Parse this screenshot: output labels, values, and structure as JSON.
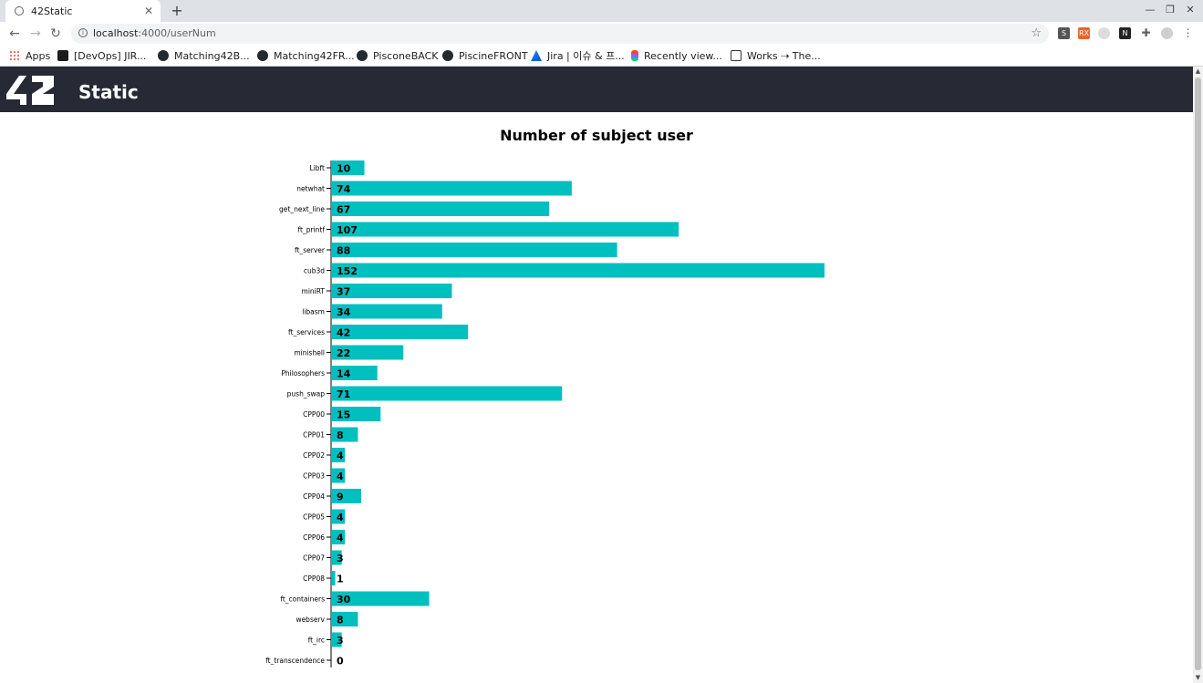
{
  "browser": {
    "tab_title": "42Static",
    "url_host": "localhost",
    "url_path": ":4000/userNum",
    "bookmarks": [
      "Apps",
      "[DevOps] JIR...",
      "Matching42B...",
      "Matching42FR...",
      "PisconeBACK",
      "PiscineFRONT",
      "Jira | 이슈 & 프...",
      "Recently view...",
      "Works ⇢ The..."
    ]
  },
  "page": {
    "brand": "Static",
    "logo_text": "42",
    "header_color": "#272a35"
  },
  "chart_data": {
    "type": "bar",
    "orientation": "horizontal",
    "title": "Number of subject user",
    "categories": [
      "Libft",
      "netwhat",
      "get_next_line",
      "ft_printf",
      "ft_server",
      "cub3d",
      "miniRT",
      "libasm",
      "ft_services",
      "minishell",
      "Philosophers",
      "push_swap",
      "CPP00",
      "CPP01",
      "CPP02",
      "CPP03",
      "CPP04",
      "CPP05",
      "CPP06",
      "CPP07",
      "CPP08",
      "ft_containers",
      "webserv",
      "ft_irc",
      "ft_transcendence"
    ],
    "values": [
      10,
      74,
      67,
      107,
      88,
      152,
      37,
      34,
      42,
      22,
      14,
      71,
      15,
      8,
      4,
      4,
      9,
      4,
      4,
      3,
      1,
      30,
      8,
      3,
      0
    ],
    "bar_color": "#00bfbf",
    "data_labels": true,
    "grid": false,
    "xlim": [
      0,
      152
    ]
  }
}
